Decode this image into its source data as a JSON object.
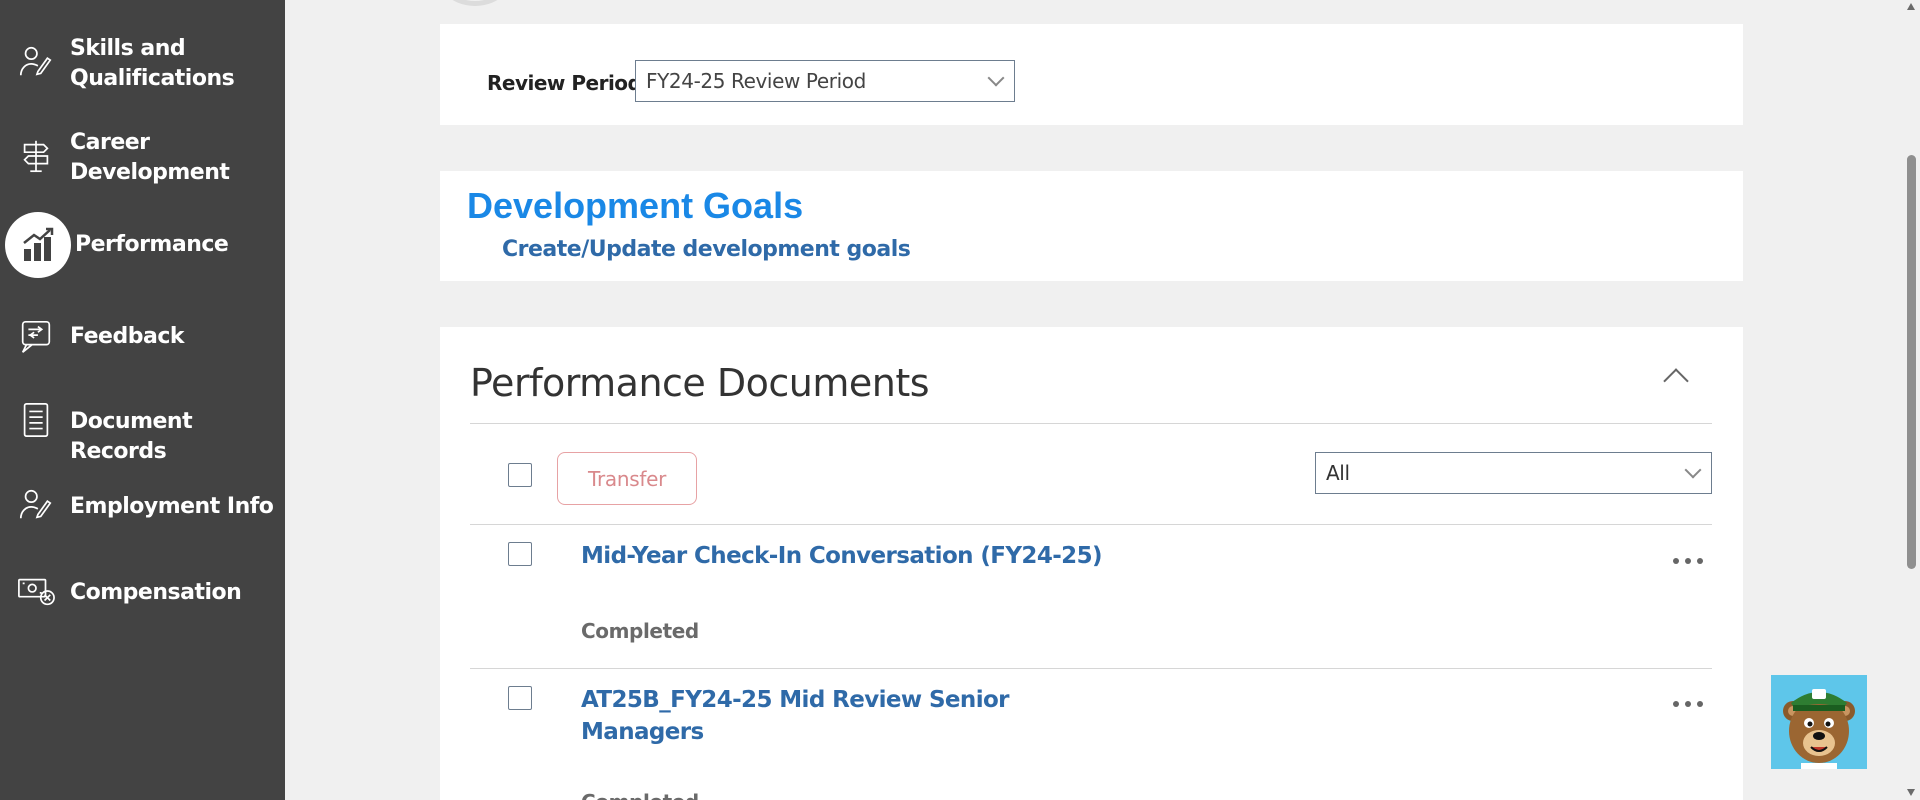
{
  "sidebar": {
    "items": [
      {
        "label": "Skills and\nQualifications",
        "icon": "person-pen-icon"
      },
      {
        "label": "Career\nDevelopment",
        "icon": "signpost-icon"
      },
      {
        "label": "Performance",
        "icon": "bar-chart-icon",
        "active": true
      },
      {
        "label": "Feedback",
        "icon": "feedback-icon"
      },
      {
        "label": "Document Records",
        "icon": "document-icon"
      },
      {
        "label": "Employment Info",
        "icon": "person-pen-icon"
      },
      {
        "label": "Compensation",
        "icon": "money-icon"
      }
    ]
  },
  "review_period": {
    "label": "Review Period",
    "selected": "FY24-25 Review Period"
  },
  "development_goals": {
    "title": "Development Goals",
    "link": "Create/Update development goals"
  },
  "performance_documents": {
    "title": "Performance Documents",
    "transfer_label": "Transfer",
    "filter_selected": "All",
    "documents": [
      {
        "title": "Mid-Year Check-In Conversation (FY24-25)",
        "status": "Completed"
      },
      {
        "title": "AT25B_FY24-25 Mid Review Senior\nManagers",
        "status": "Completed"
      }
    ]
  },
  "colors": {
    "sidebar_bg": "#434343",
    "link_blue": "#2f6aa8",
    "title_blue": "#1a88e6",
    "transfer_red": "#d9898c"
  }
}
